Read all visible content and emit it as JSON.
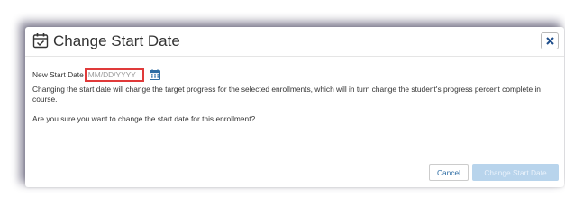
{
  "dialog": {
    "title": "Change Start Date",
    "close_icon": "close-icon",
    "title_icon": "calendar-check-icon"
  },
  "form": {
    "date_label": "New Start Date",
    "date_placeholder": "MM/DD/YYYY",
    "date_value": "",
    "calendar_icon": "calendar-icon"
  },
  "body": {
    "message": "Changing the start date will change the target progress for the selected enrollments, which will in turn change the student's progress percent complete in course.",
    "confirm_question": "Are you sure you want to change the start date for this enrollment?"
  },
  "footer": {
    "cancel_label": "Cancel",
    "confirm_label": "Change Start Date",
    "confirm_enabled": false
  },
  "colors": {
    "accent": "#2e6da4",
    "error_border": "#e03a3a",
    "disabled_button": "#b8d4ec"
  }
}
